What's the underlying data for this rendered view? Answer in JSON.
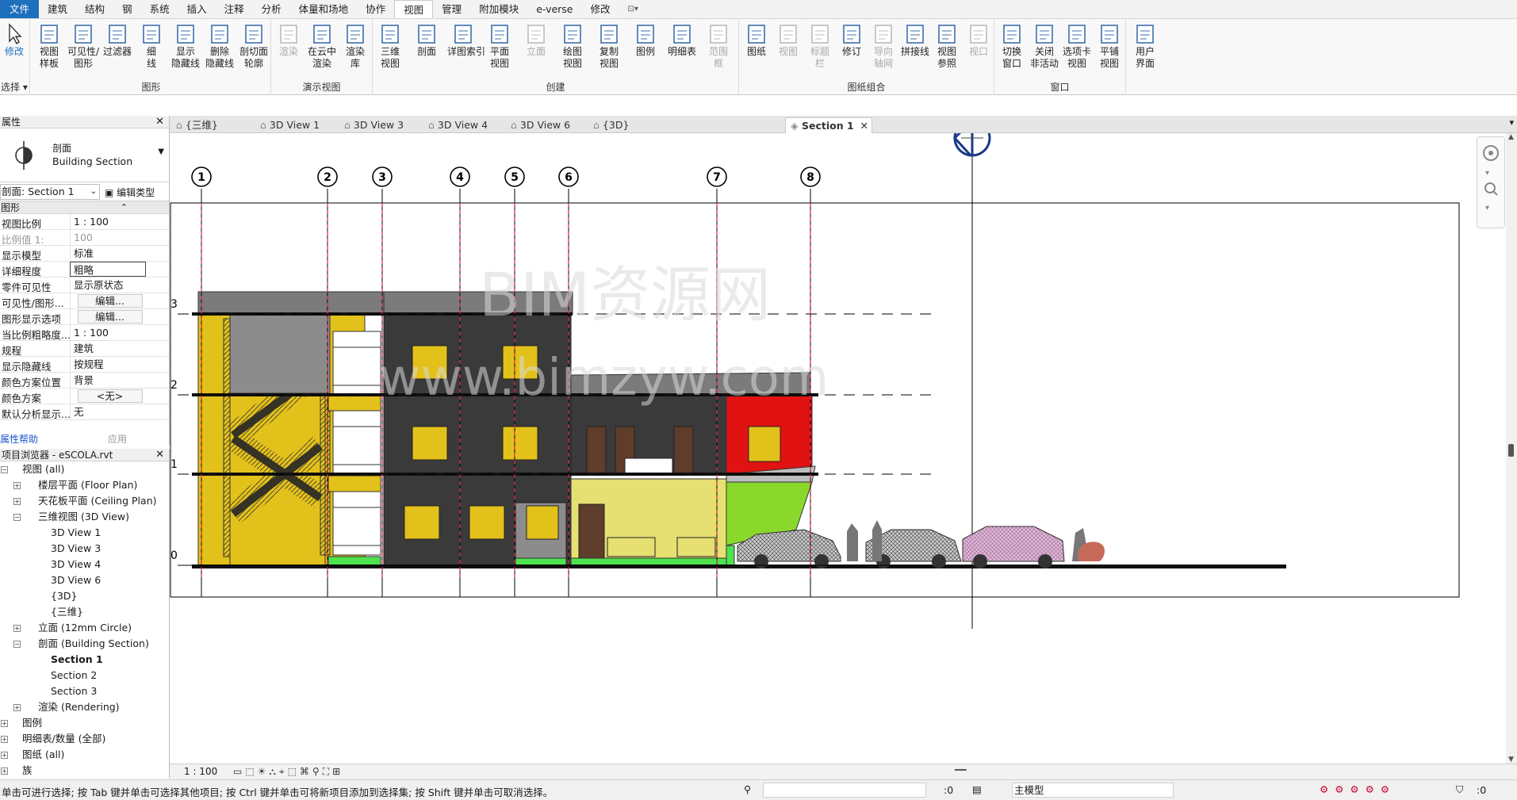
{
  "ribbon_tabs": [
    "文件",
    "建筑",
    "结构",
    "钢",
    "系统",
    "插入",
    "注释",
    "分析",
    "体量和场地",
    "协作",
    "视图",
    "管理",
    "附加模块",
    "e-verse",
    "修改"
  ],
  "ribbon_active_tab": "视图",
  "ribbon_tab_extra": "⊡▾",
  "ribbon": {
    "select": {
      "modify": "修改",
      "label": "选择 ▾"
    },
    "graphics": {
      "label": "图形",
      "buttons": [
        "视图\n样板",
        "可见性/\n图形",
        "过滤器",
        "细\n线",
        "显示\n隐藏线",
        "删除\n隐藏线",
        "剖切面\n轮廓"
      ]
    },
    "presentation": {
      "label": "演示视图",
      "buttons": [
        "渲染",
        "在云中\n渲染",
        "渲染\n库"
      ]
    },
    "create": {
      "label": "创建",
      "buttons": [
        "三维\n视图",
        "剖面",
        "详图索引",
        "平面\n视图",
        "立面",
        "绘图\n视图",
        "复制\n视图",
        "图例",
        "明细表",
        "范围\n框"
      ]
    },
    "sheet": {
      "label": "图纸组合",
      "buttons": [
        "图纸",
        "视图",
        "标题\n栏",
        "修订",
        "导向\n轴网",
        "拼接线",
        "视图\n参照",
        "视口"
      ]
    },
    "windows": {
      "label": "窗口",
      "buttons": [
        "切换\n窗口",
        "关闭\n非活动",
        "选项卡\n视图",
        "平铺\n视图"
      ]
    },
    "ui": {
      "buttons": [
        "用户\n界面"
      ]
    }
  },
  "properties": {
    "title": "属性",
    "type_line1": "剖面",
    "type_line2": "Building Section",
    "instance": "剖面: Section 1",
    "edit_type": "编辑类型",
    "category": "图形",
    "rows": [
      {
        "k": "视图比例",
        "v": "1 : 100"
      },
      {
        "k": "比例值 1:",
        "v": "100"
      },
      {
        "k": "显示模型",
        "v": "标准"
      },
      {
        "k": "详细程度",
        "v": "粗略"
      },
      {
        "k": "零件可见性",
        "v": "显示原状态"
      },
      {
        "k": "可见性/图形...",
        "v": "编辑..."
      },
      {
        "k": "图形显示选项",
        "v": "编辑..."
      },
      {
        "k": "当比例粗略度...",
        "v": "1 : 100"
      },
      {
        "k": "规程",
        "v": "建筑"
      },
      {
        "k": "显示隐藏线",
        "v": "按规程"
      },
      {
        "k": "颜色方案位置",
        "v": "背景"
      },
      {
        "k": "颜色方案",
        "v": "<无>"
      },
      {
        "k": "默认分析显示...",
        "v": "无"
      }
    ],
    "help": "属性帮助",
    "apply": "应用"
  },
  "browser": {
    "title": "项目浏览器 - eSCOLA.rvt",
    "items": [
      {
        "t": "视图 (all)"
      },
      {
        "t": "楼层平面 (Floor Plan)"
      },
      {
        "t": "天花板平面 (Ceiling Plan)"
      },
      {
        "t": "三维视图 (3D View)"
      },
      {
        "t": "3D View 1"
      },
      {
        "t": "3D View 3"
      },
      {
        "t": "3D View 4"
      },
      {
        "t": "3D View 6"
      },
      {
        "t": "{3D}"
      },
      {
        "t": "{三维}"
      },
      {
        "t": "立面 (12mm Circle)"
      },
      {
        "t": "剖面 (Building Section)"
      },
      {
        "t": "Section 1"
      },
      {
        "t": "Section 2"
      },
      {
        "t": "Section 3"
      },
      {
        "t": "渲染 (Rendering)"
      },
      {
        "t": "图例"
      },
      {
        "t": "明细表/数量 (全部)"
      },
      {
        "t": "图纸 (all)"
      },
      {
        "t": "族"
      }
    ]
  },
  "view_tabs": [
    "{三维}",
    "3D View 1",
    "3D View 3",
    "3D View 4",
    "3D View 6",
    "{3D}",
    "Section 1"
  ],
  "active_view": "Section 1",
  "grids": [
    "1",
    "2",
    "3",
    "4",
    "5",
    "6",
    "7",
    "8"
  ],
  "levels": [
    "3",
    "2",
    "1",
    "0"
  ],
  "watermark": {
    "line1": "BIM资源网",
    "line2": "www.bimzyw.com"
  },
  "view_control_scale": "1 : 100",
  "status": {
    "message": "单击可进行选择; 按 Tab 键并单击可选择其他项目; 按 Ctrl 键并单击可将新项目添加到选择集; 按 Shift 键并单击可取消选择。",
    "zoom": ":0",
    "model": "主模型",
    "filter": ":0"
  }
}
